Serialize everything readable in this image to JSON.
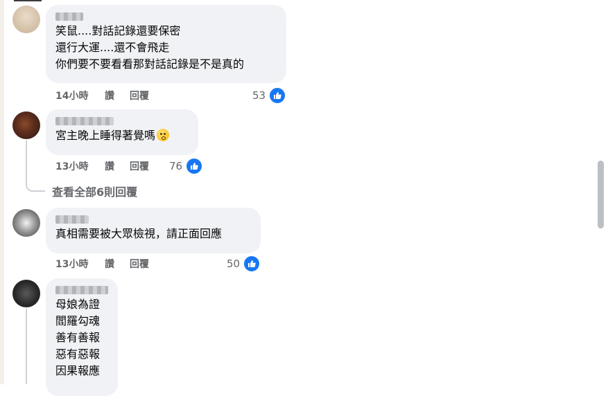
{
  "comments": [
    {
      "text": "笑鼠....對話記錄還要保密\n還行大運....還不會飛走\n你們要不要看看那對話記錄是不是真的",
      "time": "14小時",
      "like_label": "讚",
      "reply_label": "回覆",
      "reaction_count": "53"
    },
    {
      "text": "宮主晚上睡得著覺嗎",
      "time": "13小時",
      "like_label": "讚",
      "reply_label": "回覆",
      "reaction_count": "76"
    },
    {
      "text": "真相需要被大眾檢視，請正面回應",
      "time": "13小時",
      "like_label": "讚",
      "reply_label": "回覆",
      "reaction_count": "50"
    },
    {
      "text": "母娘為證\n閻羅勾魂\n善有善報\n惡有惡報\n因果報應"
    }
  ],
  "view_replies": "查看全部6則回覆",
  "colors": {
    "bubble": "#f0f2f5",
    "meta": "#65676b",
    "like_blue": "#1877f2"
  },
  "icons": {
    "reaction": "thumbs-up-icon",
    "emoji": "worried-face-icon"
  }
}
